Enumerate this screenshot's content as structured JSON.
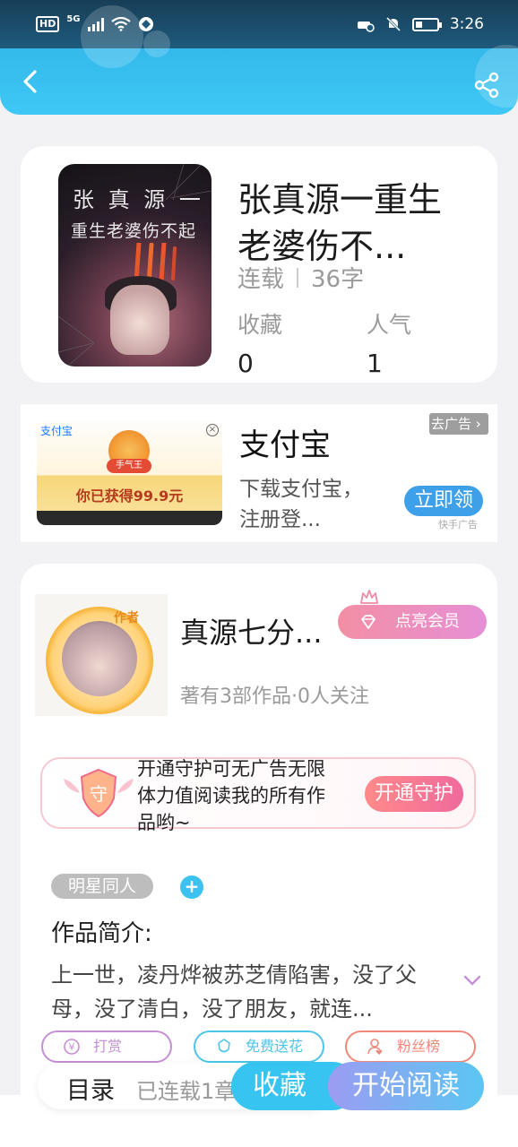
{
  "status_bar": {
    "hd": "HD",
    "network": "5G",
    "time": "3:26",
    "battery_level": 0.3
  },
  "book": {
    "title": "张真源一重生老婆伤不...",
    "cover_title_line1": "张 真 源 一",
    "cover_title_line2": "重生老婆伤不起",
    "status": "连载",
    "word_count": "36字",
    "favorites_label": "收藏",
    "favorites_value": "0",
    "popularity_label": "人气",
    "popularity_value": "1"
  },
  "ad": {
    "app_label": "支付宝",
    "badge": "手气王",
    "prize_text": "你已获得99.9元",
    "title": "支付宝",
    "description": "下载支付宝，注册登...",
    "close_label": "去广告",
    "cta": "立即领",
    "source": "快手广告"
  },
  "author": {
    "badge": "作者",
    "name": "真源七分...",
    "vip_button": "点亮会员",
    "works_info": "著有3部作品·0人关注",
    "guard_text": "开通守护可无广告无限体力值阅读我的所有作品哟~",
    "guard_icon_text": "守",
    "guard_button": "开通守护",
    "tag": "明星同人",
    "tag_add": "+",
    "intro_title": "作品简介:",
    "intro_text": "上一世，凌丹烨被苏芝倩陷害，没了父母，没了清白，没了朋友，就连...",
    "actions": [
      {
        "label": "打赏",
        "color": "#c58fd6"
      },
      {
        "label": "免费送花",
        "color": "#4cc6e8"
      },
      {
        "label": "粉丝榜",
        "color": "#f0887a"
      }
    ]
  },
  "bottom": {
    "toc": "目录",
    "toc_count": "已连载1章",
    "favorite": "收藏",
    "read": "开始阅读"
  }
}
